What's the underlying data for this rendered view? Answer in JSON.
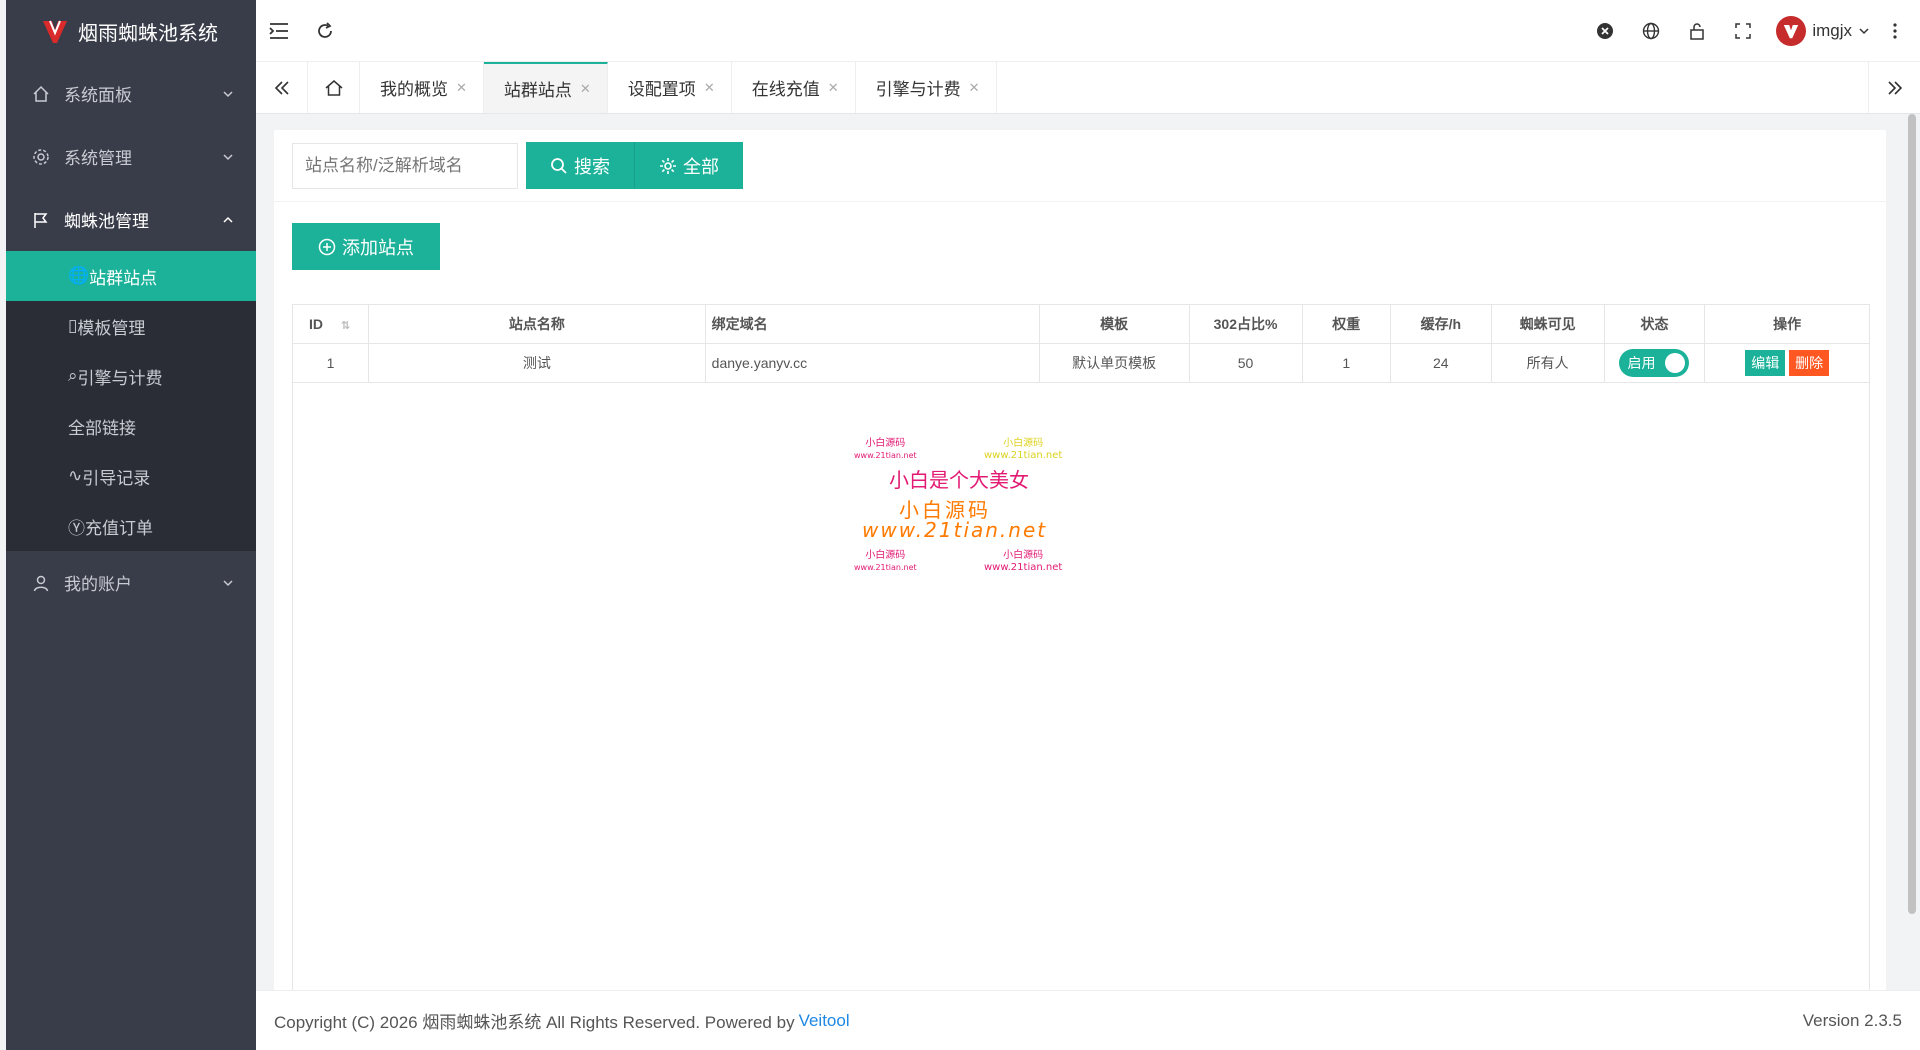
{
  "brand": {
    "title": "烟雨蜘蛛池系统"
  },
  "sidebar": {
    "items": [
      {
        "label": "系统面板"
      },
      {
        "label": "系统管理"
      },
      {
        "label": "蜘蛛池管理"
      },
      {
        "label": "我的账户"
      }
    ],
    "sub_items": [
      {
        "label": "站群站点"
      },
      {
        "label": "模板管理"
      },
      {
        "label": "引擎与计费"
      },
      {
        "label": "全部链接"
      },
      {
        "label": "引导记录"
      },
      {
        "label": "充值订单"
      }
    ]
  },
  "header": {
    "username": "imgjx"
  },
  "tabs": [
    {
      "label": "我的概览"
    },
    {
      "label": "站群站点"
    },
    {
      "label": "设配置项"
    },
    {
      "label": "在线充值"
    },
    {
      "label": "引擎与计费"
    }
  ],
  "search": {
    "placeholder": "站点名称/泛解析域名",
    "search_label": "搜索",
    "all_label": "全部"
  },
  "add_label": "添加站点",
  "table": {
    "headers": [
      "ID",
      "站点名称",
      "绑定域名",
      "模板",
      "302占比%",
      "权重",
      "缓存/h",
      "蜘蛛可见",
      "状态",
      "操作"
    ],
    "rows": [
      {
        "id": "1",
        "name": "测试",
        "domain": "danye.yanyv.cc",
        "template": "默认单页模板",
        "ratio": "50",
        "weight": "1",
        "cache": "24",
        "visible": "所有人",
        "status": "启用",
        "edit": "编辑",
        "del": "删除"
      }
    ]
  },
  "watermark": {
    "small1": "小白源码",
    "small1_url": "www.21tian.net",
    "small2": "小白源码",
    "small2_url": "www.21tian.net",
    "title": "小白是个大美女",
    "mid": "小白源码",
    "mid_url": "www.21tian.net",
    "small3": "小白源码",
    "small3_url": "www.21tian.net",
    "small4": "小白源码",
    "small4_url": "www.21tian.net"
  },
  "footer": {
    "copyright": "Copyright (C) 2026 烟雨蜘蛛池系统 All Rights Reserved. Powered by",
    "powered": "Veitool",
    "version": "Version 2.3.5"
  },
  "colors": {
    "accent": "#1cb29a",
    "sidebar": "#393d49",
    "danger": "#ff5722"
  }
}
